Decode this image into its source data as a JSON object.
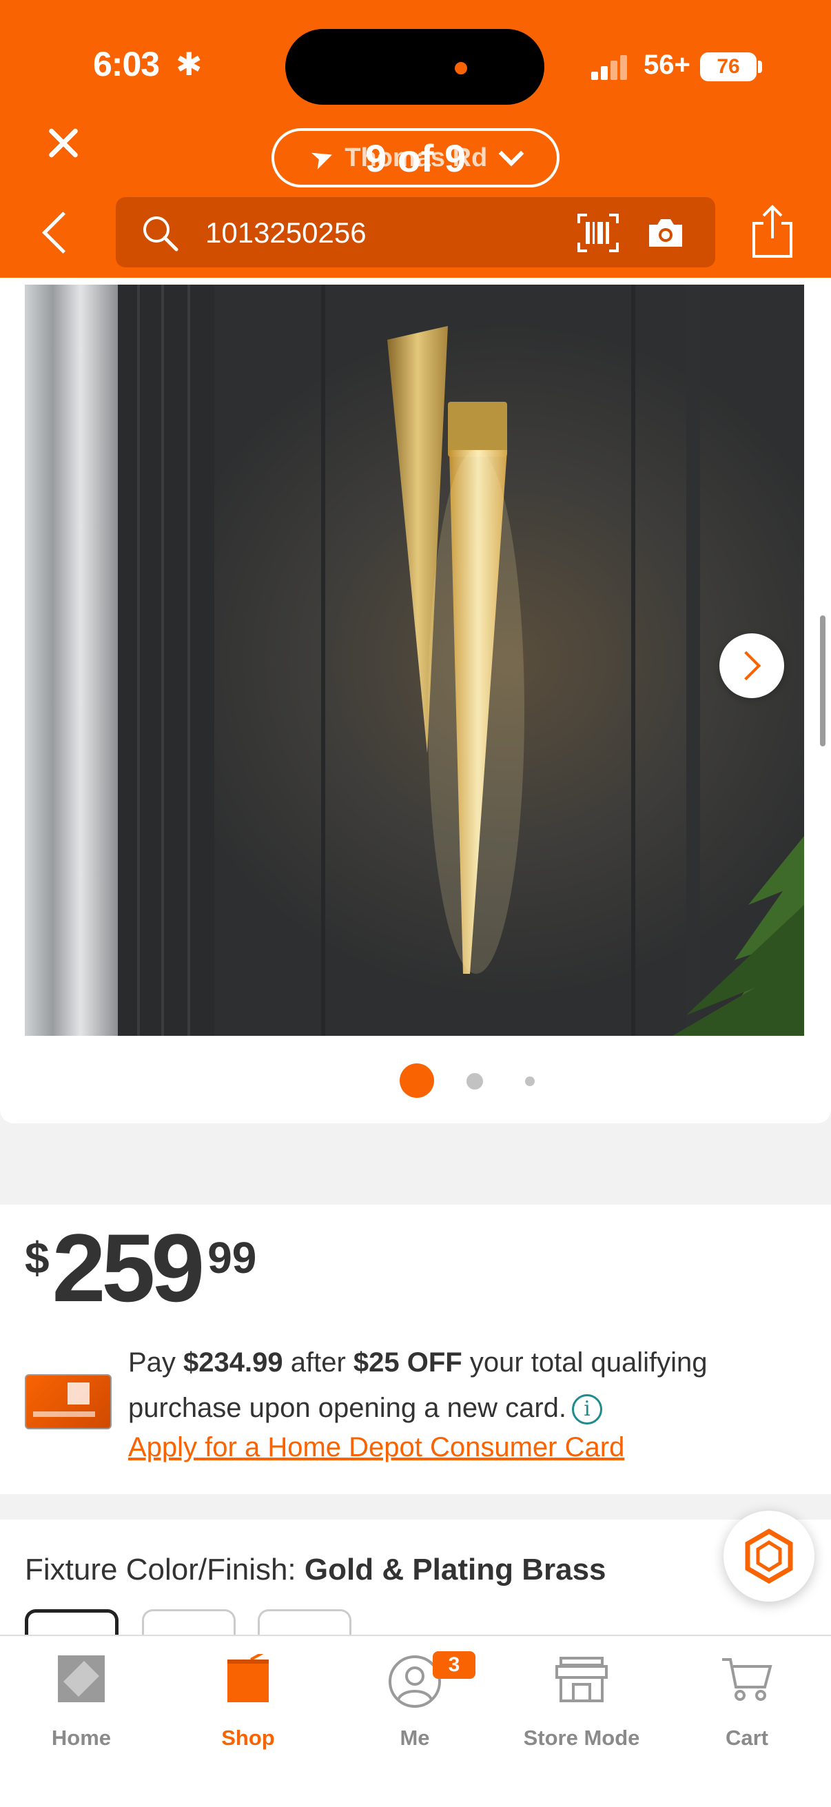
{
  "status_bar": {
    "time": "6:03",
    "network": "56+",
    "battery": "76"
  },
  "header": {
    "store_name": "Thomas Rd",
    "image_counter": "9 of 9",
    "search_value": "1013250256"
  },
  "gallery": {
    "image_alt": "Gold crystal wall sconce",
    "dots_total": 3,
    "dots_active": 0
  },
  "price": {
    "currency": "$",
    "dollars": "259",
    "cents": "99"
  },
  "promo": {
    "line_pre": "Pay ",
    "discounted_price": "$234.99",
    "line_mid": " after ",
    "discount": "$25 OFF",
    "line_post": " your total qualifying purchase upon opening a new card.",
    "info_glyph": "i",
    "apply_link": "Apply for a Home Depot Consumer Card"
  },
  "finish": {
    "label": "Fixture Color/Finish: ",
    "value": "Gold & Plating Brass"
  },
  "tabbar": {
    "tabs": [
      {
        "label": "Home"
      },
      {
        "label": "Shop"
      },
      {
        "label": "Me",
        "badge": "3"
      },
      {
        "label": "Store Mode"
      },
      {
        "label": "Cart"
      }
    ],
    "active_index": 1
  },
  "colors": {
    "brand_orange": "#f96302",
    "search_bg": "#d14d00",
    "info_teal": "#1e8c8c"
  }
}
